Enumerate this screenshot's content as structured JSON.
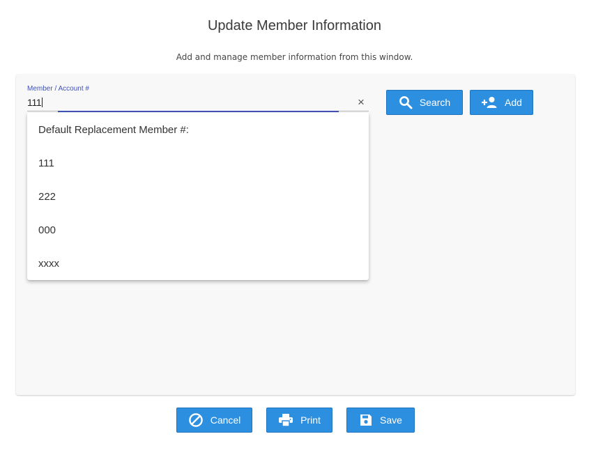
{
  "header": {
    "title": "Update Member Information",
    "subtitle": "Add and manage member information from this window."
  },
  "member_field": {
    "label": "Member / Account #",
    "value": "111",
    "clear_icon": "close-icon"
  },
  "search_button": {
    "label": "Search",
    "icon": "search-icon"
  },
  "add_button": {
    "label": "Add",
    "icon": "add-user-icon"
  },
  "dropdown": {
    "options": [
      "Default Replacement Member #:",
      "111",
      "222",
      "000",
      "xxxx"
    ]
  },
  "footer": {
    "cancel_label": "Cancel",
    "print_label": "Print",
    "save_label": "Save"
  },
  "colors": {
    "primary_button": "#2d8fe0",
    "focus_accent": "#3f51b5",
    "panel_background": "#f8f8f9"
  }
}
